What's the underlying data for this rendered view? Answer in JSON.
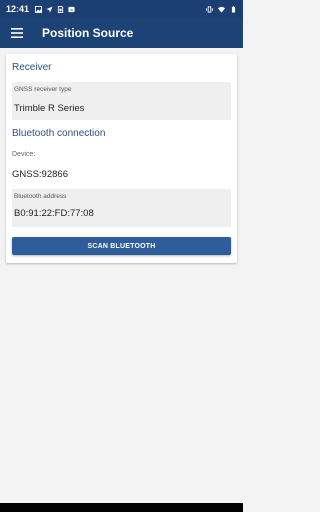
{
  "status_bar": {
    "time": "12:41",
    "icons_left": [
      "gallery-icon",
      "navigation-arrow-icon",
      "sim-card-icon",
      "cloud-icon"
    ],
    "icons_right": [
      "vibrate-icon",
      "wifi-icon",
      "battery-icon"
    ]
  },
  "app_bar": {
    "title": "Position Source",
    "menu_icon": "hamburger-menu-icon",
    "color": "#1d4275"
  },
  "receiver": {
    "section_title": "Receiver",
    "gnss_type_label": "GNSS receiver type",
    "gnss_type_value": "Trimble R Series"
  },
  "bluetooth": {
    "section_title": "Bluetooth connection",
    "device_label": "Device:",
    "device_value": "GNSS:92866",
    "address_label": "Bluetooth address",
    "address_value": "B0:91:22:FD:77:08",
    "scan_button_label": "SCAN BLUETOOTH"
  },
  "colors": {
    "accent": "#2f5c9a",
    "section_title": "#2d4f86"
  }
}
